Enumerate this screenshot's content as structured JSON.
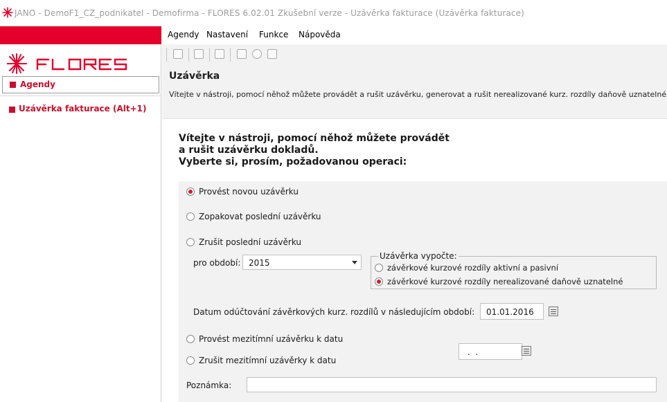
{
  "window": {
    "title": "JANO - DemoF1_CZ_podnikatel - Demofirma - FLORES 6.02.01 Zkušební verze - Uzávěrka fakturace  (Uzávěrka fakturace)"
  },
  "sidebar": {
    "logo_text": "FLORES",
    "section_label": "Agendy",
    "nav_item_label": "Uzávěrka fakturace (Alt+1)"
  },
  "menubar": {
    "items": [
      "Agendy",
      "Nastavení",
      "Funkce",
      "Nápověda"
    ]
  },
  "header": {
    "title": "Uzávěrka",
    "description": "Vítejte v nástroji, pomocí něhož můžete provádět a rušit uzávěrku, generovat a rušit nerealizované kurz. rozdíly daňově uznatelné"
  },
  "intro": {
    "line1": "Vítejte v nástroji, pomocí něhož můžete provádět",
    "line2": "a rušit uzávěrku dokladů.",
    "line3": "Vyberte si, prosím, požadovanou operaci:"
  },
  "options": {
    "new_closing": "Provést novou uzávěrku",
    "repeat_last": "Zopakovat poslední uzávěrku",
    "cancel_last": "Zrušit poslední uzávěrku",
    "period_label": "pro období:",
    "period_value": "2015",
    "calc_legend": "Uzávěrka vypočte:",
    "calc_active_passive": "závěrkové kurzové rozdíly aktivní a pasivní",
    "calc_unrealized": "závěrkové kurzové rozdíly nerealizované daňově uznatelné",
    "posting_date_label": "Datum odúčtování závěrkových kurz. rozdílů v následujícím období:",
    "posting_date_value": "01.01.2016",
    "interim_closing": "Provést mezitímní uzávěrku k datu",
    "cancel_interim": "Zrušit mezitímní uzávěrky k datu",
    "interim_date_value": " .  .",
    "note_label": "Poznámka:",
    "note_value": ""
  },
  "colors": {
    "brand_red": "#e4002b",
    "accent_red": "#c8102e",
    "panel_gray": "#f2f2f2"
  }
}
